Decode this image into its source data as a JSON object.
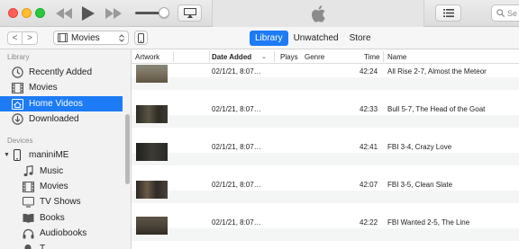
{
  "window": {
    "search_placeholder": "Se"
  },
  "toolbar": {
    "back_label": "<",
    "forward_label": ">",
    "media_select": "Movies",
    "tabs": [
      {
        "label": "Library",
        "active": true
      },
      {
        "label": "Unwatched",
        "active": false
      },
      {
        "label": "Store",
        "active": false
      }
    ]
  },
  "sidebar": {
    "library_header": "Library",
    "library_items": [
      {
        "label": "Recently Added",
        "icon": "clock-icon",
        "selected": false
      },
      {
        "label": "Movies",
        "icon": "film-icon",
        "selected": false
      },
      {
        "label": "Home Videos",
        "icon": "home-video-icon",
        "selected": true
      },
      {
        "label": "Downloaded",
        "icon": "download-icon",
        "selected": false
      }
    ],
    "devices_header": "Devices",
    "device_name": "maniniME",
    "device_items": [
      {
        "label": "Music",
        "icon": "music-note-icon"
      },
      {
        "label": "Movies",
        "icon": "film-icon"
      },
      {
        "label": "TV Shows",
        "icon": "tv-icon"
      },
      {
        "label": "Books",
        "icon": "book-icon"
      },
      {
        "label": "Audiobooks",
        "icon": "headphones-icon"
      },
      {
        "label": "T",
        "icon": "tones-icon"
      }
    ]
  },
  "table": {
    "columns": {
      "artwork": "Artwork",
      "date_added": "Date Added",
      "plays": "Plays",
      "genre": "Genre",
      "time": "Time",
      "name": "Name"
    },
    "rows": [
      {
        "date_added": "02/1/21, 8:07…",
        "time": "42:24",
        "name": "All Rise 2-7, Almost the Meteor",
        "thumb": "#6f6550"
      },
      {
        "date_added": "02/1/21, 8:07…",
        "time": "42:33",
        "name": "Bull 5-7, The Head of the Goat",
        "thumb": "#3c3a31"
      },
      {
        "date_added": "02/1/21, 8:07…",
        "time": "42:41",
        "name": "FBI 3-4, Crazy Love",
        "thumb": "#2d2d28"
      },
      {
        "date_added": "02/1/21, 8:07…",
        "time": "42:07",
        "name": "FBI 3-5, Clean Slate",
        "thumb": "#3a3530"
      },
      {
        "date_added": "02/1/21, 8:07…",
        "time": "42:22",
        "name": "FBI Wanted 2-5, The Line",
        "thumb": "#4b4438"
      }
    ]
  },
  "colors": {
    "accent": "#1d7bf5"
  }
}
